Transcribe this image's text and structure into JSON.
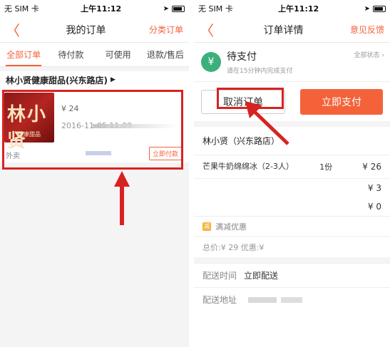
{
  "left": {
    "status": {
      "carrier": "无 SIM 卡",
      "time": "上午11:12"
    },
    "nav": {
      "back": "〈",
      "title": "我的订单",
      "action": "分类订单"
    },
    "tabs": [
      "全部订单",
      "待付款",
      "可使用",
      "退款/售后"
    ],
    "shop": {
      "name": "林小贤健康甜品(兴东路店)",
      "arrow": "▶"
    },
    "order": {
      "img_big": "林小贤",
      "img_small": "健康甜品",
      "price": "¥ 24",
      "datetime": "2016-11-05 11:09",
      "type": "外卖",
      "pay": "立即付款"
    }
  },
  "right": {
    "status": {
      "carrier": "无 SIM 卡",
      "time": "上午11:12"
    },
    "nav": {
      "back": "〈",
      "title": "订单详情",
      "action": "意见反馈"
    },
    "pending": {
      "title": "待支付",
      "subtitle": "请在15分钟内完成支付",
      "all_status": "全部状态 ›"
    },
    "actions": {
      "cancel": "取消订单",
      "pay": "立即支付"
    },
    "shop": "林小贤（兴东路店）",
    "items": [
      {
        "name": "芒果牛奶绵绵冰（2-3人）",
        "qty": "1份",
        "amount": "¥ 26"
      }
    ],
    "fees": [
      "¥ 3",
      "¥ 0"
    ],
    "promo": {
      "tag": "减",
      "label": "满减优惠"
    },
    "total": "总价:¥ 29  优惠:¥",
    "delivery": [
      {
        "key": "配送时间",
        "value": "立即配送"
      },
      {
        "key": "配送地址",
        "value": ""
      }
    ]
  },
  "colors": {
    "accent": "#f4623a",
    "annotation": "#d82222",
    "pending_icon": "#3bb07c"
  }
}
